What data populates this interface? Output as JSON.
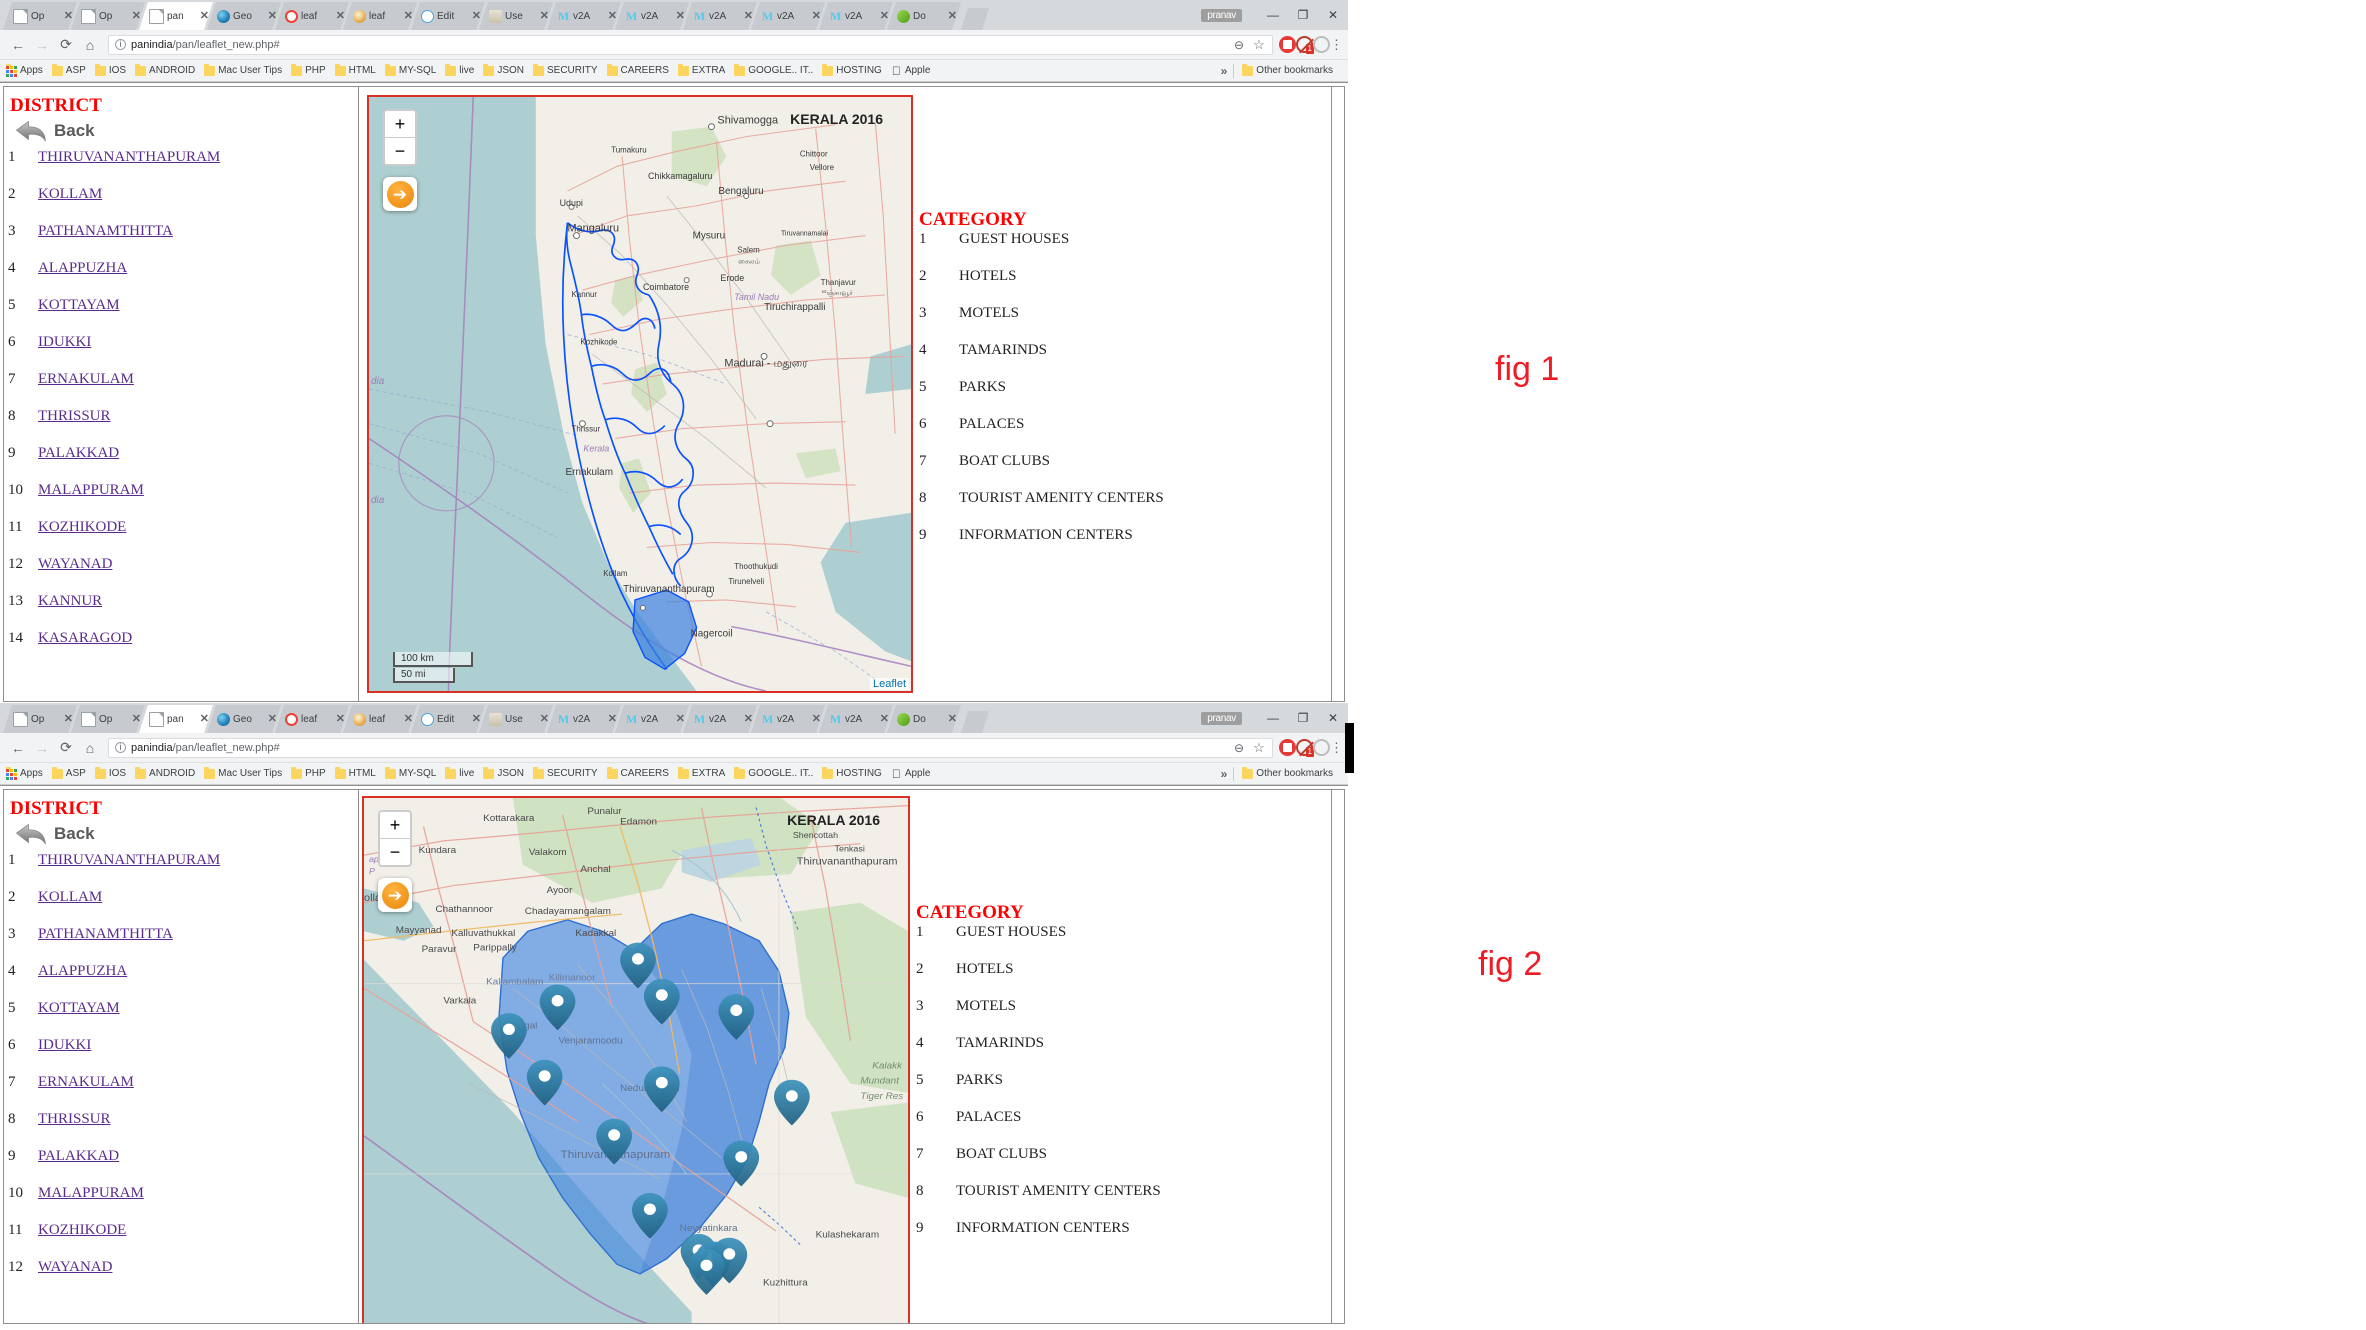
{
  "browser": {
    "profile_name": "pranav",
    "url_host": "panindia",
    "url_path": "/pan/leaflet_new.php#",
    "url_full": "panindia/pan/leaflet_new.php#",
    "secure_icon": "info-icon",
    "window_buttons": {
      "minimize": "—",
      "maximize": "❐",
      "close": "✕"
    },
    "nav": {
      "back": "←",
      "forward": "→",
      "reload": "⟳",
      "home": "⌂"
    },
    "omnibox_icons": {
      "zoom_out": "⊖",
      "bookmark_star": "☆"
    },
    "menu_icon": "⋮",
    "tabs": [
      {
        "label": "Op",
        "icon": "doc-icon",
        "active": false
      },
      {
        "label": "Op",
        "icon": "doc-icon",
        "active": false
      },
      {
        "label": "pan",
        "icon": "doc-icon",
        "active": true
      },
      {
        "label": "Geo",
        "icon": "globe-icon",
        "active": false
      },
      {
        "label": "leaf",
        "icon": "google-icon",
        "active": false
      },
      {
        "label": "leaf",
        "icon": "leaflet-icon",
        "active": false
      },
      {
        "label": "Edit",
        "icon": "cloud-icon",
        "active": false
      },
      {
        "label": "Use",
        "icon": "java-icon",
        "active": false
      },
      {
        "label": "v2A",
        "icon": "m-icon",
        "active": false
      },
      {
        "label": "v2A",
        "icon": "m-icon",
        "active": false
      },
      {
        "label": "v2A",
        "icon": "m-icon",
        "active": false
      },
      {
        "label": "v2A",
        "icon": "m-icon",
        "active": false
      },
      {
        "label": "v2A",
        "icon": "m-icon",
        "active": false
      },
      {
        "label": "Do",
        "icon": "green-icon",
        "active": false
      }
    ],
    "bookmarks": [
      {
        "label": "Apps",
        "icon": "apps-grid-icon"
      },
      {
        "label": "ASP",
        "icon": "folder-icon"
      },
      {
        "label": "IOS",
        "icon": "folder-icon"
      },
      {
        "label": "ANDROID",
        "icon": "folder-icon"
      },
      {
        "label": "Mac User Tips",
        "icon": "folder-icon"
      },
      {
        "label": "PHP",
        "icon": "folder-icon"
      },
      {
        "label": "HTML",
        "icon": "folder-icon"
      },
      {
        "label": "MY-SQL",
        "icon": "folder-icon"
      },
      {
        "label": "live",
        "icon": "folder-icon"
      },
      {
        "label": "JSON",
        "icon": "folder-icon"
      },
      {
        "label": "SECURITY",
        "icon": "folder-icon"
      },
      {
        "label": "CAREERS",
        "icon": "folder-icon"
      },
      {
        "label": "EXTRA",
        "icon": "folder-icon"
      },
      {
        "label": "GOOGLE.. IT..",
        "icon": "folder-icon"
      },
      {
        "label": "HOSTING",
        "icon": "folder-icon"
      },
      {
        "label": "Apple",
        "icon": "apple-icon"
      }
    ],
    "bookmarks_overflow": "»",
    "other_bookmarks": "Other bookmarks",
    "extension_badge_count": "1"
  },
  "app": {
    "district_panel": {
      "title": "DISTRICT",
      "back_label": "Back",
      "items": [
        {
          "n": "1",
          "name": "THIRUVANANTHAPURAM"
        },
        {
          "n": "2",
          "name": "KOLLAM"
        },
        {
          "n": "3",
          "name": "PATHANAMTHITTA"
        },
        {
          "n": "4",
          "name": "ALAPPUZHA"
        },
        {
          "n": "5",
          "name": "KOTTAYAM"
        },
        {
          "n": "6",
          "name": "IDUKKI"
        },
        {
          "n": "7",
          "name": "ERNAKULAM"
        },
        {
          "n": "8",
          "name": "THRISSUR"
        },
        {
          "n": "9",
          "name": "PALAKKAD"
        },
        {
          "n": "10",
          "name": "MALAPPURAM"
        },
        {
          "n": "11",
          "name": "KOZHIKODE"
        },
        {
          "n": "12",
          "name": "WAYANAD"
        },
        {
          "n": "13",
          "name": "KANNUR"
        },
        {
          "n": "14",
          "name": "KASARAGOD"
        }
      ]
    },
    "category_panel": {
      "title": "CATEGORY",
      "items": [
        {
          "n": "1",
          "name": "GUEST HOUSES"
        },
        {
          "n": "2",
          "name": "HOTELS"
        },
        {
          "n": "3",
          "name": "MOTELS"
        },
        {
          "n": "4",
          "name": "TAMARINDS"
        },
        {
          "n": "5",
          "name": "PARKS"
        },
        {
          "n": "6",
          "name": "PALACES"
        },
        {
          "n": "7",
          "name": "BOAT CLUBS"
        },
        {
          "n": "8",
          "name": "TOURIST AMENITY CENTERS"
        },
        {
          "n": "9",
          "name": "INFORMATION CENTERS"
        }
      ]
    },
    "map": {
      "title_overlay": "KERALA 2016",
      "zoom_in": "+",
      "zoom_out": "−",
      "back_button_icon": "back-arrow-circle-icon",
      "scale_km": "100 km",
      "scale_mi": "50 mi",
      "attribution": "Leaflet",
      "highlight_color": "#1f77d0",
      "boundary_color": "#0a52ff",
      "marker_color": "#2e7fa8",
      "water_color": "#aecfd1",
      "land_color": "#f2efe9",
      "fig1_labels": [
        "Shivamogga",
        "Tumakuru",
        "Udupi",
        "Chikkamagaluru",
        "Mangaluru",
        "Bengaluru",
        "Vellore",
        "Mysuru",
        "Tiruvannamalai",
        "Salem",
        "Kannur",
        "Kozhikode",
        "Erode",
        "Coimbatore",
        "Thanjavur",
        "Thrissur",
        "Kerala",
        "Tamil Nadu",
        "Tiruchirappalli",
        "Ernakulam",
        "Madurai",
        "Kollam",
        "Thiruvananthapuram",
        "Thoothukudi",
        "Tirunelveli",
        "Nagercoil",
        "Chittoor",
        "India"
      ],
      "fig2_labels": [
        "Kottarakara",
        "Punalur",
        "Edamon",
        "Kundara",
        "Valakom",
        "Anchal",
        "Kollam",
        "Chathannoor",
        "Ayoor",
        "Chadayamangalam",
        "Mayyanad",
        "Kalluvathukkal",
        "Kadakkal",
        "Paravur",
        "Parippally",
        "Kallambalam",
        "Kilimanoor",
        "Varkala",
        "Attingal",
        "Venjaramoodu",
        "Nedumangad",
        "Thiruvananthapuram",
        "Neyyatinkara",
        "Kulashekaram",
        "Kuzhittura",
        "Shencottah",
        "Tenkasi",
        "Kalakkad Mundanthurai Tiger Reserve"
      ],
      "fig2_marker_count": 15
    }
  },
  "figures": {
    "fig1": "fig 1",
    "fig2": "fig 2"
  }
}
